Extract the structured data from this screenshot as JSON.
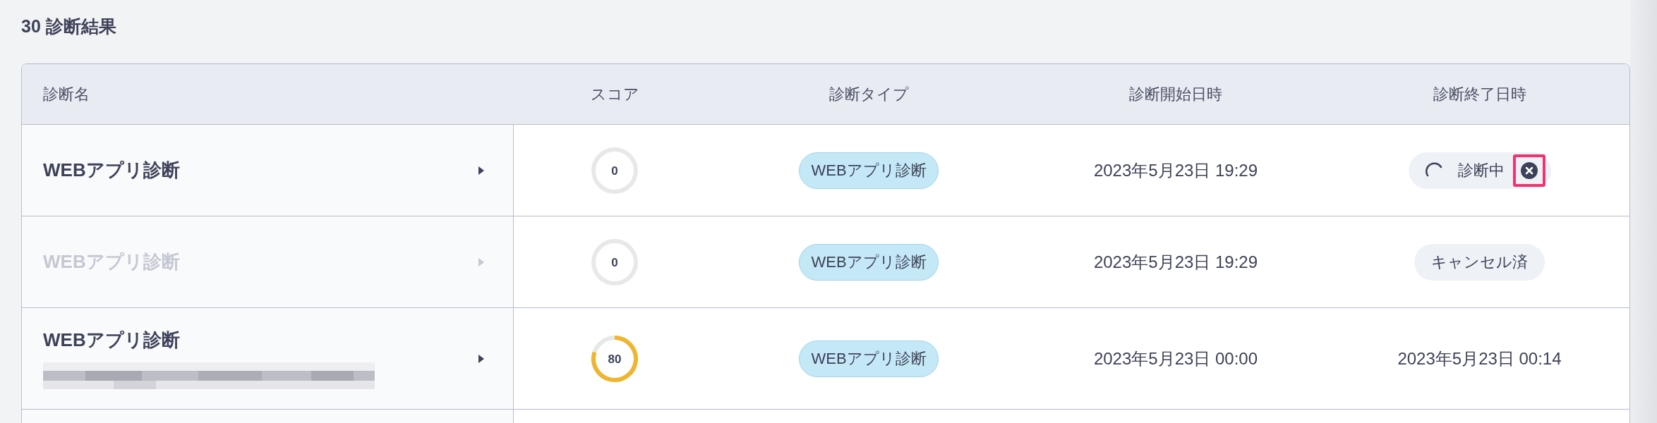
{
  "heading": "30 診断結果",
  "columns": [
    "診断名",
    "スコア",
    "診断タイプ",
    "診断開始日時",
    "診断終了日時"
  ],
  "rows": [
    {
      "name": "WEBアプリ診断",
      "disabled": false,
      "score": "0",
      "type": "WEBアプリ診断",
      "start": "2023年5月23日 19:29",
      "end": {
        "kind": "running",
        "label": "診断中",
        "highlighted": true
      }
    },
    {
      "name": "WEBアプリ診断",
      "disabled": true,
      "score": "0",
      "type": "WEBアプリ診断",
      "start": "2023年5月23日 19:29",
      "end": {
        "kind": "cancelled",
        "label": "キャンセル済"
      }
    },
    {
      "name": "WEBアプリ診断",
      "disabled": false,
      "score": "80",
      "type": "WEBアプリ診断",
      "start": "2023年5月23日 00:00",
      "end": {
        "kind": "date",
        "label": "2023年5月23日 00:14"
      }
    }
  ]
}
